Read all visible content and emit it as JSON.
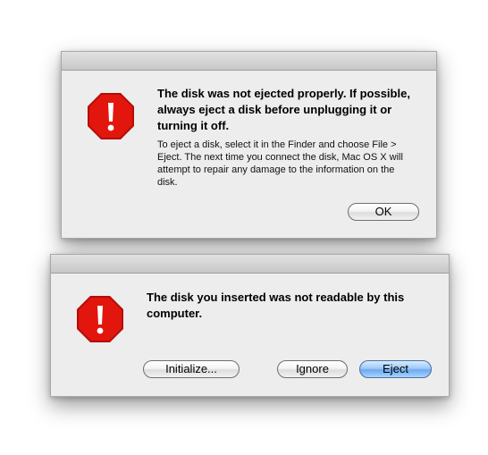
{
  "dialogs": [
    {
      "title": "The disk was not ejected properly. If possible, always eject a disk before unplugging it or turning it off.",
      "body": "To eject a disk, select it in the Finder and choose File > Eject. The next time you connect the disk, Mac OS X will attempt to repair any damage to the information on the disk.",
      "icon": "stop-alert-icon",
      "buttons": [
        {
          "label": "OK",
          "default": false
        }
      ]
    },
    {
      "title": "The disk you inserted was not readable by this computer.",
      "icon": "stop-alert-icon",
      "buttons": [
        {
          "label": "Initialize...",
          "default": false
        },
        {
          "label": "Ignore",
          "default": false
        },
        {
          "label": "Eject",
          "default": true
        }
      ]
    }
  ],
  "colors": {
    "stop_icon_fill": "#e2160d",
    "default_button": "#6eaaf0",
    "dialog_background": "#ededed"
  }
}
